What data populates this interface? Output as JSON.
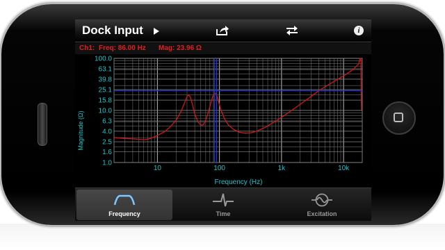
{
  "navbar": {
    "title": "Dock Input",
    "play_icon": "play-icon",
    "share_icon": "share-icon",
    "swap_icon": "swap-arrows-icon",
    "info_icon": "info-icon",
    "info_glyph": "i"
  },
  "readout": {
    "channel": "Ch1:",
    "freq": "Freq: 86.00 Hz",
    "mag": "Mag: 23.96 Ω",
    "color": "#e02020"
  },
  "chart_data": {
    "type": "line",
    "title": "",
    "xlabel": "Frequency (Hz)",
    "ylabel": "Magnitude (Ω)",
    "x_scale": "log",
    "y_scale": "log",
    "xlim": [
      2,
      20000
    ],
    "ylim": [
      1.0,
      100.0
    ],
    "x_ticks": [
      10,
      100,
      1000,
      10000
    ],
    "x_tick_labels": [
      "10",
      "100",
      "1k",
      "10k"
    ],
    "y_ticks": [
      100.0,
      63.1,
      39.8,
      25.1,
      15.8,
      10.0,
      6.3,
      4.0,
      2.5,
      1.6,
      1.0
    ],
    "y_tick_labels": [
      "100.0",
      "63.1",
      "39.8",
      "25.1",
      "15.8",
      "10.0",
      "6.3",
      "4.0",
      "2.5",
      "1.6",
      "1.0"
    ],
    "grid": true,
    "cursor": {
      "x": 86.0,
      "y": 23.96,
      "color": "#2233cc"
    },
    "series": [
      {
        "color": "#d01818",
        "points": [
          [
            2,
            3.0
          ],
          [
            3,
            2.9
          ],
          [
            4,
            2.85
          ],
          [
            5,
            2.8
          ],
          [
            6,
            2.75
          ],
          [
            7,
            2.8
          ],
          [
            8,
            2.95
          ],
          [
            10,
            3.3
          ],
          [
            13,
            3.9
          ],
          [
            16,
            4.8
          ],
          [
            20,
            6.5
          ],
          [
            24,
            9.5
          ],
          [
            27,
            13.5
          ],
          [
            30,
            18.5
          ],
          [
            32,
            19.8
          ],
          [
            34,
            18.0
          ],
          [
            37,
            12.5
          ],
          [
            40,
            8.5
          ],
          [
            45,
            6.0
          ],
          [
            50,
            5.2
          ],
          [
            55,
            5.3
          ],
          [
            60,
            6.5
          ],
          [
            66,
            9.0
          ],
          [
            72,
            13.5
          ],
          [
            78,
            18.5
          ],
          [
            84,
            21.5
          ],
          [
            88,
            21.0
          ],
          [
            95,
            16.0
          ],
          [
            105,
            10.5
          ],
          [
            120,
            7.0
          ],
          [
            140,
            5.2
          ],
          [
            170,
            4.3
          ],
          [
            210,
            3.8
          ],
          [
            260,
            3.65
          ],
          [
            320,
            3.7
          ],
          [
            420,
            4.1
          ],
          [
            560,
            4.8
          ],
          [
            800,
            6.2
          ],
          [
            1200,
            8.5
          ],
          [
            1800,
            12.0
          ],
          [
            2800,
            17.5
          ],
          [
            4200,
            25.0
          ],
          [
            6500,
            34.0
          ],
          [
            10000,
            46.0
          ],
          [
            14000,
            60.0
          ],
          [
            17500,
            78.0
          ],
          [
            18500,
            100.0
          ],
          [
            19000,
            100.0
          ],
          [
            19500,
            10.0
          ]
        ]
      }
    ]
  },
  "tabs": [
    {
      "label": "Frequency",
      "icon": "frequency-icon",
      "active": true
    },
    {
      "label": "Time",
      "icon": "time-icon",
      "active": false
    },
    {
      "label": "Excitation",
      "icon": "excitation-icon",
      "active": false
    }
  ]
}
